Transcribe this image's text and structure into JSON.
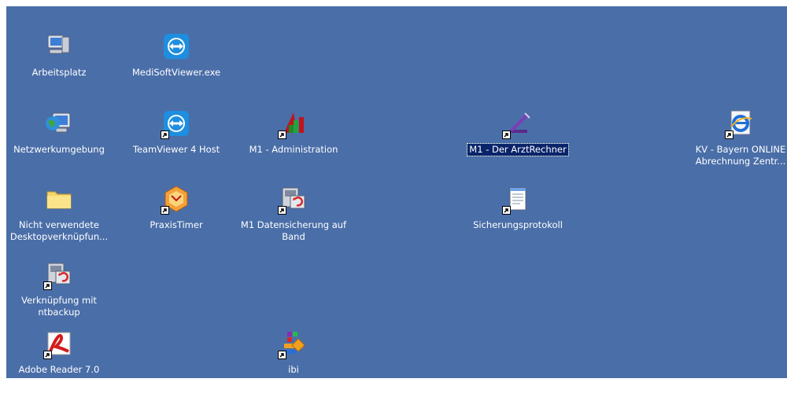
{
  "desktop": {
    "background_color": "#4a6ea8",
    "icons": [
      {
        "label": "Arbeitsplatz",
        "icon": "my-computer-icon",
        "shortcut": false
      },
      {
        "label": "MediSoftViewer.exe",
        "icon": "teamviewer-icon",
        "shortcut": false
      },
      {
        "label": "Netzwerkumgebung",
        "icon": "network-places-icon",
        "shortcut": false
      },
      {
        "label": "TeamViewer 4 Host",
        "icon": "teamviewer-icon",
        "shortcut": true
      },
      {
        "label": "M1 - Administration",
        "icon": "m1-admin-icon",
        "shortcut": true
      },
      {
        "label": "M1 - Der ArztRechner",
        "icon": "m1-arztrechner-icon",
        "shortcut": true,
        "selected": true
      },
      {
        "label": "KV - Bayern  ONLINE Abrechnung Zentr...",
        "icon": "internet-explorer-icon",
        "shortcut": true
      },
      {
        "label": "Nicht verwendete Desktopverknüpfun...",
        "icon": "folder-icon",
        "shortcut": false
      },
      {
        "label": "PraxisTimer",
        "icon": "praxistimer-icon",
        "shortcut": true
      },
      {
        "label": "M1 Datensicherung auf Band",
        "icon": "backup-icon",
        "shortcut": true
      },
      {
        "label": "Sicherungsprotokoll",
        "icon": "notepad-icon",
        "shortcut": true
      },
      {
        "label": "Verknüpfung mit ntbackup",
        "icon": "backup-icon",
        "shortcut": true
      },
      {
        "label": "Adobe Reader 7.0",
        "icon": "adobe-reader-icon",
        "shortcut": true
      },
      {
        "label": "ibi",
        "icon": "ibi-icon",
        "shortcut": true
      }
    ]
  }
}
